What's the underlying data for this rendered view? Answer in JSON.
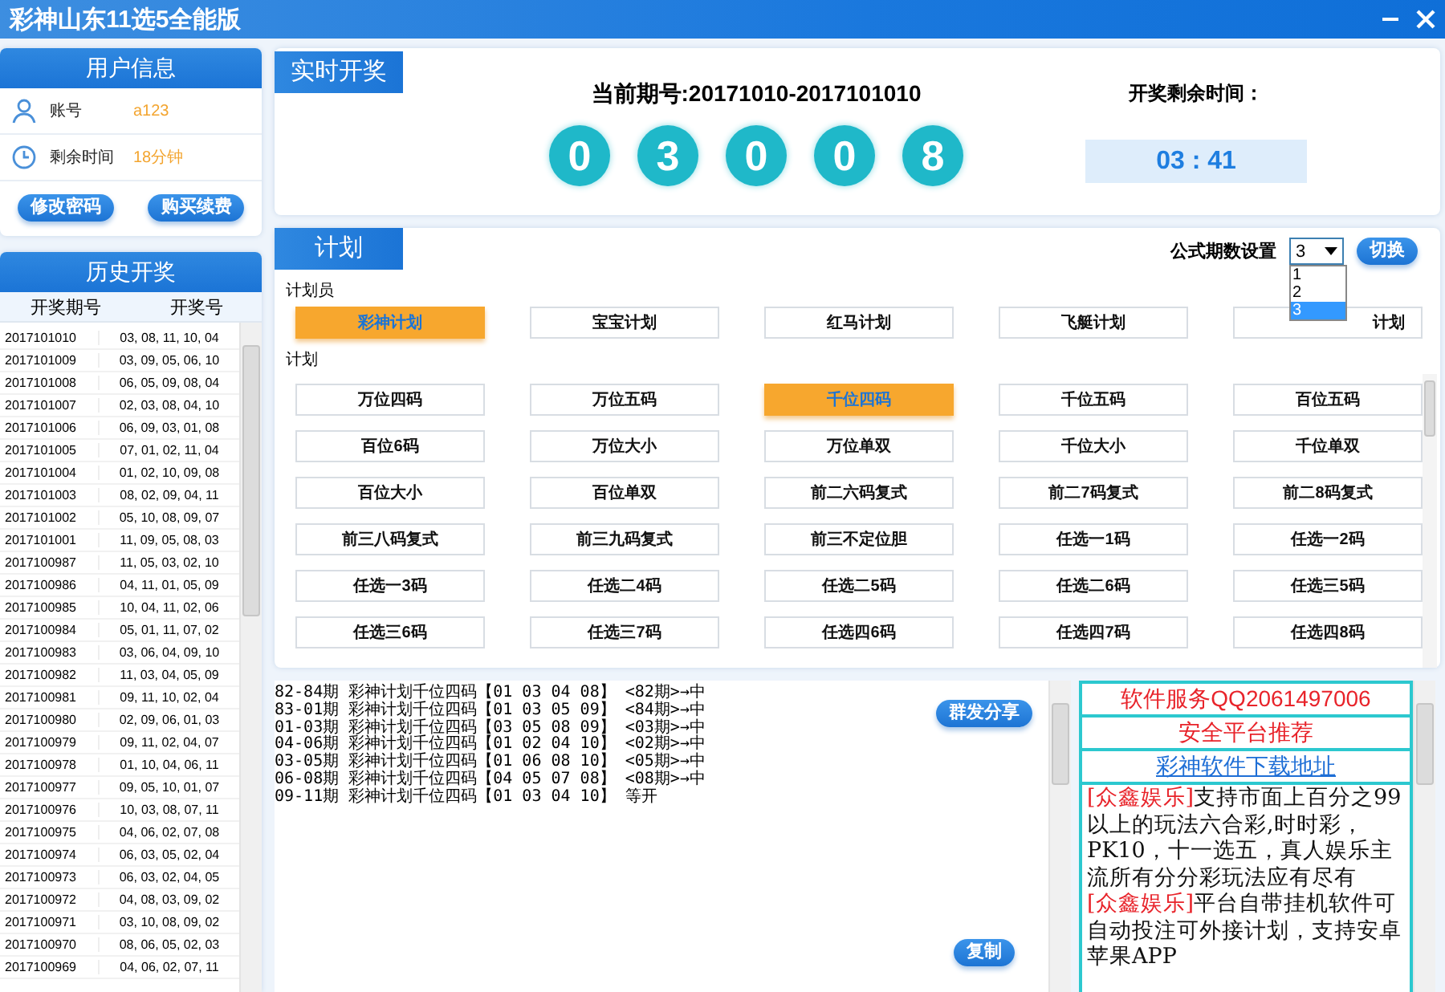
{
  "window": {
    "title": "彩神山东11选5全能版"
  },
  "user_info": {
    "title": "用户信息",
    "fields": [
      {
        "kind": "account",
        "label": "账号",
        "value": "a123"
      },
      {
        "kind": "time",
        "label": "剩余时间",
        "value": "18分钟"
      }
    ],
    "buttons": [
      "修改密码",
      "购买续费"
    ]
  },
  "history": {
    "title": "历史开奖",
    "columns": [
      "开奖期号",
      "开奖号"
    ],
    "rows": [
      [
        "2017101010",
        "03, 08, 11, 10, 04"
      ],
      [
        "2017101009",
        "03, 09, 05, 06, 10"
      ],
      [
        "2017101008",
        "06, 05, 09, 08, 04"
      ],
      [
        "2017101007",
        "02, 03, 08, 04, 10"
      ],
      [
        "2017101006",
        "06, 09, 03, 01, 08"
      ],
      [
        "2017101005",
        "07, 01, 02, 11, 04"
      ],
      [
        "2017101004",
        "01, 02, 10, 09, 08"
      ],
      [
        "2017101003",
        "08, 02, 09, 04, 11"
      ],
      [
        "2017101002",
        "05, 10, 08, 09, 07"
      ],
      [
        "2017101001",
        "11, 09, 05, 08, 03"
      ],
      [
        "2017100987",
        "11, 05, 03, 02, 10"
      ],
      [
        "2017100986",
        "04, 11, 01, 05, 09"
      ],
      [
        "2017100985",
        "10, 04, 11, 02, 06"
      ],
      [
        "2017100984",
        "05, 01, 11, 07, 02"
      ],
      [
        "2017100983",
        "03, 06, 04, 09, 10"
      ],
      [
        "2017100982",
        "11, 03, 04, 05, 09"
      ],
      [
        "2017100981",
        "09, 11, 10, 02, 04"
      ],
      [
        "2017100980",
        "02, 09, 06, 01, 03"
      ],
      [
        "2017100979",
        "09, 11, 02, 04, 07"
      ],
      [
        "2017100978",
        "01, 10, 04, 06, 11"
      ],
      [
        "2017100977",
        "09, 05, 10, 01, 07"
      ],
      [
        "2017100976",
        "10, 03, 08, 07, 11"
      ],
      [
        "2017100975",
        "04, 06, 02, 07, 08"
      ],
      [
        "2017100974",
        "06, 03, 05, 02, 04"
      ],
      [
        "2017100973",
        "06, 03, 02, 04, 05"
      ],
      [
        "2017100972",
        "04, 08, 03, 09, 02"
      ],
      [
        "2017100971",
        "03, 10, 08, 09, 02"
      ],
      [
        "2017100970",
        "08, 06, 05, 02, 03"
      ],
      [
        "2017100969",
        "04, 06, 02, 07, 11"
      ]
    ]
  },
  "realtime": {
    "title": "实时开奖",
    "issue_label": "当前期号:20171010-2017101010",
    "balls": [
      "0",
      "3",
      "0",
      "0",
      "8"
    ],
    "countdown_label": "开奖剩余时间：",
    "countdown": "03 : 41"
  },
  "plan": {
    "title": "计划",
    "period_label": "公式期数设置",
    "period_select": {
      "value": "3",
      "expanded": true,
      "options": [
        {
          "label": "1",
          "selected": false
        },
        {
          "label": "2",
          "selected": false
        },
        {
          "label": "3",
          "selected": true
        }
      ]
    },
    "switch_button": "切换",
    "planner_label": "计划员",
    "planners": [
      {
        "label": "彩神计划",
        "selected": true
      },
      {
        "label": "宝宝计划",
        "selected": false
      },
      {
        "label": "红马计划",
        "selected": false
      },
      {
        "label": "飞艇计划",
        "selected": false
      },
      {
        "label": "计划",
        "selected": false
      }
    ],
    "plans_label": "计划",
    "plans": [
      {
        "label": "万位四码",
        "selected": false
      },
      {
        "label": "万位五码",
        "selected": false
      },
      {
        "label": "千位四码",
        "selected": true
      },
      {
        "label": "千位五码",
        "selected": false
      },
      {
        "label": "百位五码",
        "selected": false
      },
      {
        "label": "百位6码",
        "selected": false
      },
      {
        "label": "万位大小",
        "selected": false
      },
      {
        "label": "万位单双",
        "selected": false
      },
      {
        "label": "千位大小",
        "selected": false
      },
      {
        "label": "千位单双",
        "selected": false
      },
      {
        "label": "百位大小",
        "selected": false
      },
      {
        "label": "百位单双",
        "selected": false
      },
      {
        "label": "前二六码复式",
        "selected": false
      },
      {
        "label": "前二7码复式",
        "selected": false
      },
      {
        "label": "前二8码复式",
        "selected": false
      },
      {
        "label": "前三八码复式",
        "selected": false
      },
      {
        "label": "前三九码复式",
        "selected": false
      },
      {
        "label": "前三不定位胆",
        "selected": false
      },
      {
        "label": "任选一1码",
        "selected": false
      },
      {
        "label": "任选一2码",
        "selected": false
      },
      {
        "label": "任选一3码",
        "selected": false
      },
      {
        "label": "任选二4码",
        "selected": false
      },
      {
        "label": "任选二5码",
        "selected": false
      },
      {
        "label": "任选二6码",
        "selected": false
      },
      {
        "label": "任选三5码",
        "selected": false
      },
      {
        "label": "任选三6码",
        "selected": false
      },
      {
        "label": "任选三7码",
        "selected": false
      },
      {
        "label": "任选四6码",
        "selected": false
      },
      {
        "label": "任选四7码",
        "selected": false
      },
      {
        "label": "任选四8码",
        "selected": false
      }
    ]
  },
  "output": {
    "lines": [
      "82-84期 彩神计划千位四码【01 03 04 08】 <82期>→中",
      "83-01期 彩神计划千位四码【01 03 05 09】 <84期>→中",
      "01-03期 彩神计划千位四码【03 05 08 09】 <03期>→中",
      "04-06期 彩神计划千位四码【01 02 04 10】 <02期>→中",
      "03-05期 彩神计划千位四码【01 06 08 10】 <05期>→中",
      "06-08期 彩神计划千位四码【04 05 07 08】 <08期>→中",
      "09-11期 彩神计划千位四码【01 03 04 10】 等开"
    ],
    "share_button": "群发分享",
    "copy_button": "复制"
  },
  "ads": {
    "items": [
      {
        "kind": "title",
        "text": "软件服务QQ2061497006"
      },
      {
        "kind": "title",
        "text": "安全平台推荐"
      },
      {
        "kind": "link",
        "text": "彩神软件下载地址"
      },
      {
        "kind": "paragraph",
        "tag": "[众鑫娱乐]",
        "text": "支持市面上百分之99以上的玩法六合彩,时时彩，PK10，十一选五，真人娱乐主流所有分分彩玩法应有尽有"
      },
      {
        "kind": "paragraph",
        "tag": "[众鑫娱乐]",
        "text": "平台自带挂机软件可自动投注可外接计划，支持安卓苹果APP"
      }
    ]
  }
}
